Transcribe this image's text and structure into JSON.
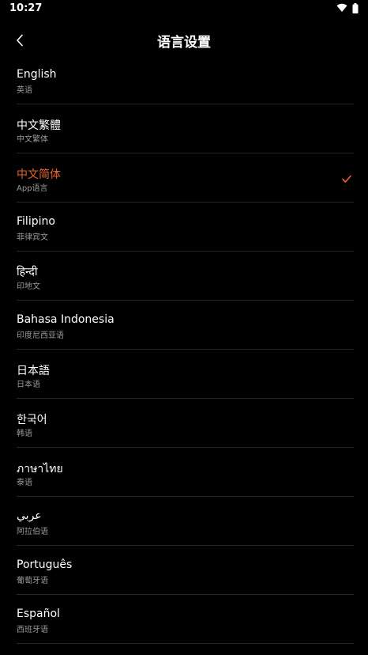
{
  "status_bar": {
    "time": "10:27",
    "icons": [
      "wifi-icon",
      "battery-icon"
    ]
  },
  "header": {
    "back_icon": "chevron-left-icon",
    "title": "语言设置"
  },
  "colors": {
    "accent": "#e8642c",
    "background": "#000000",
    "divider": "#262626",
    "subtext": "#9a9a9a"
  },
  "languages": [
    {
      "name": "English",
      "subtitle": "英语",
      "selected": false
    },
    {
      "name": "中文繁體",
      "subtitle": "中文繁体",
      "selected": false
    },
    {
      "name": "中文简体",
      "subtitle": "App语言",
      "selected": true
    },
    {
      "name": "Filipino",
      "subtitle": "菲律宾文",
      "selected": false
    },
    {
      "name": "हिन्दी",
      "subtitle": "印地文",
      "selected": false
    },
    {
      "name": "Bahasa Indonesia",
      "subtitle": "印度尼西亚语",
      "selected": false
    },
    {
      "name": "日本語",
      "subtitle": "日本语",
      "selected": false
    },
    {
      "name": "한국어",
      "subtitle": "韩语",
      "selected": false
    },
    {
      "name": "ภาษาไทย",
      "subtitle": "泰语",
      "selected": false
    },
    {
      "name": "عربي",
      "subtitle": "阿拉伯语",
      "selected": false
    },
    {
      "name": "Português",
      "subtitle": "葡萄牙语",
      "selected": false
    },
    {
      "name": "Español",
      "subtitle": "西班牙语",
      "selected": false
    }
  ]
}
